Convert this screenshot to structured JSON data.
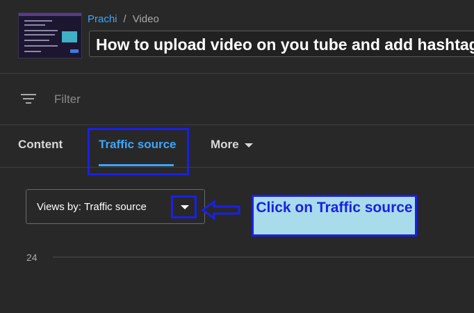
{
  "header": {
    "channel": "Prachi",
    "separator": "/",
    "section": "Video",
    "video_title": "How to upload video on you tube and add hashtags"
  },
  "filter": {
    "icon": "filter-icon",
    "label": "Filter"
  },
  "tabs": [
    {
      "label": "Content",
      "active": false
    },
    {
      "label": "Traffic source",
      "active": true
    },
    {
      "label": "More",
      "active": false
    }
  ],
  "dropdown": {
    "label": "Views by: Traffic source",
    "icon": "caret-down-icon"
  },
  "callout": {
    "text": "Click on Traffic source",
    "bg_color": "#a8dceb",
    "border_color": "#1a20e6"
  },
  "chart": {
    "y_tick": "24"
  },
  "colors": {
    "background": "#282828",
    "accent": "#3ea6ff",
    "annotation": "#1a20e6"
  }
}
